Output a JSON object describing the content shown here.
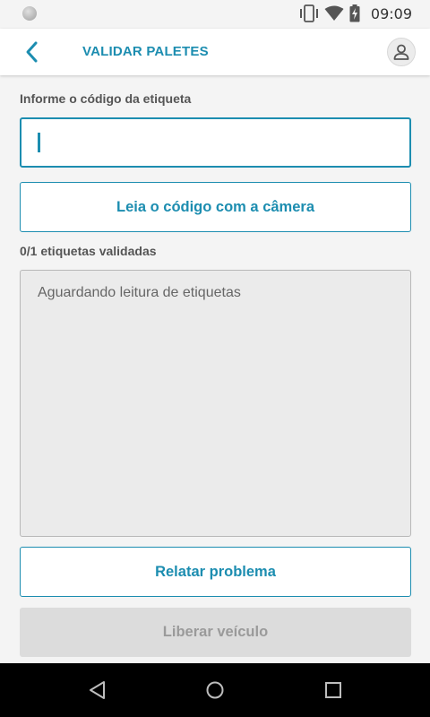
{
  "status_bar": {
    "time": "09:09",
    "icons": [
      "notification-dot-icon",
      "vibrate-icon",
      "wifi-icon",
      "battery-charging-icon"
    ]
  },
  "app_bar": {
    "title": "VALIDAR PALETES",
    "icons": [
      "back-arrow-icon",
      "user-profile-icon"
    ]
  },
  "form": {
    "code_label": "Informe o código da etiqueta",
    "code_value": "",
    "camera_button": "Leia o código com a câmera",
    "validated_count": "0/1 etiquetas validadas",
    "empty_message": "Aguardando leitura de etiquetas"
  },
  "actions": {
    "report_problem": "Relatar problema",
    "release_vehicle": "Liberar veículo"
  },
  "nav_bar": {
    "icons": [
      "nav-back-icon",
      "nav-home-icon",
      "nav-recents-icon"
    ]
  },
  "colors": {
    "accent": "#1c8db0",
    "background": "#f4f4f4",
    "disabled_bg": "#dcdcdc",
    "disabled_text": "#9a9a9a"
  }
}
